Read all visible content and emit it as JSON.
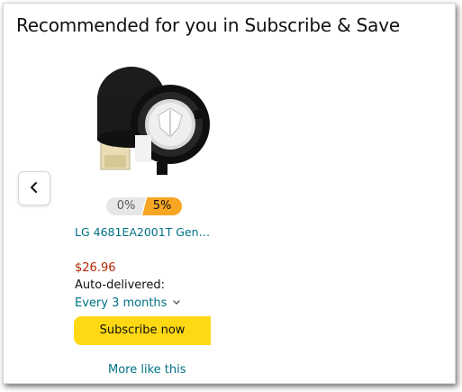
{
  "header": {
    "title": "Recommended for you in Subscribe & Save"
  },
  "carousel": {
    "prev_icon": "chevron-left-icon"
  },
  "product": {
    "image": "drain-pump-image",
    "discount_badges": [
      "0%",
      "5%"
    ],
    "title": "LG 4681EA2001T Gen…",
    "price": "$26.96",
    "auto_delivered_label": "Auto-delivered:",
    "frequency": "Every 3 months",
    "frequency_icon": "chevron-down-icon",
    "subscribe_label": "Subscribe now",
    "more_like_this": "More like this"
  },
  "colors": {
    "link": "#007185",
    "price": "#b12704",
    "subscribe_button": "#ffd814",
    "badge_active": "#f6a623"
  }
}
